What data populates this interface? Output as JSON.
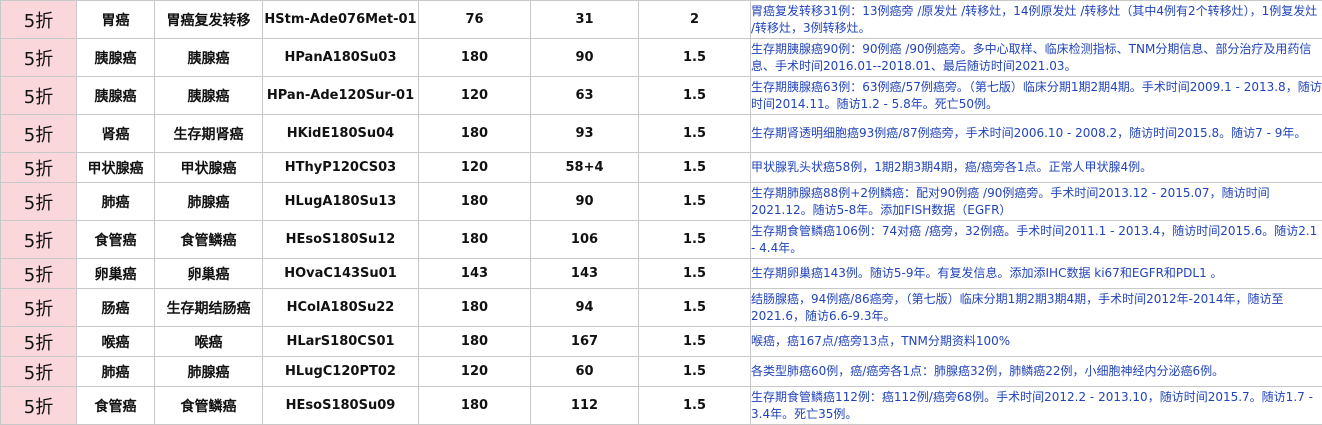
{
  "table": {
    "rows": [
      {
        "discount": "5折",
        "cancer": "胃癌",
        "subtype": "胃癌复发转移",
        "code": "HStm-Ade076Met-01",
        "cases": "76",
        "samples": "31",
        "size": "2",
        "desc": "胃癌复发转移31例：13例癌旁 /原发灶 /转移灶，14例原发灶 /转移灶（其中4例有2个转移灶），1例复发灶 /转移灶，3例转移灶。"
      },
      {
        "discount": "5折",
        "cancer": "胰腺癌",
        "subtype": "胰腺癌",
        "code": "HPanA180Su03",
        "cases": "180",
        "samples": "90",
        "size": "1.5",
        "desc": "生存期胰腺癌90例：90例癌 /90例癌旁。多中心取样、临床检测指标、TNM分期信息、部分治疗及用药信息、手术时间2016.01--2018.01、最后随访时间2021.03。"
      },
      {
        "discount": "5折",
        "cancer": "胰腺癌",
        "subtype": "胰腺癌",
        "code": "HPan-Ade120Sur-01",
        "cases": "120",
        "samples": "63",
        "size": "1.5",
        "desc": "生存期胰腺癌63例：63例癌/57例癌旁。（第七版）临床分期1期2期4期。手术时间2009.1 - 2013.8，随访时间2014.11。随访1.2 - 5.8年。死亡50例。"
      },
      {
        "discount": "5折",
        "cancer": "肾癌",
        "subtype": "生存期肾癌",
        "code": "HKidE180Su04",
        "cases": "180",
        "samples": "93",
        "size": "1.5",
        "desc": "生存期肾透明细胞癌93例癌/87例癌旁，手术时间2006.10 - 2008.2，随访时间2015.8。随访7 - 9年。"
      },
      {
        "discount": "5折",
        "cancer": "甲状腺癌",
        "subtype": "甲状腺癌",
        "code": "HThyP120CS03",
        "cases": "120",
        "samples": "58+4",
        "size": "1.5",
        "desc": "甲状腺乳头状癌58例，1期2期3期4期，癌/癌旁各1点。正常人甲状腺4例。"
      },
      {
        "discount": "5折",
        "cancer": "肺癌",
        "subtype": "肺腺癌",
        "code": "HLugA180Su13",
        "cases": "180",
        "samples": "90",
        "size": "1.5",
        "desc": "生存期肺腺癌88例+2例鳞癌：配对90例癌 /90例癌旁。手术时间2013.12 - 2015.07，随访时间2021.12。随访5-8年。添加FISH数据（EGFR）"
      },
      {
        "discount": "5折",
        "cancer": "食管癌",
        "subtype": "食管鳞癌",
        "code": "HEsoS180Su12",
        "cases": "180",
        "samples": "106",
        "size": "1.5",
        "desc": "生存期食管鳞癌106例：74对癌 /癌旁，32例癌。手术时间2011.1 - 2013.4，随访时间2015.6。随访2.1 - 4.4年。"
      },
      {
        "discount": "5折",
        "cancer": "卵巢癌",
        "subtype": "卵巢癌",
        "code": "HOvaC143Su01",
        "cases": "143",
        "samples": "143",
        "size": "1.5",
        "desc": "生存期卵巢癌143例。随访5-9年。有复发信息。添加添IHC数据 ki67和EGFR和PDL1 。"
      },
      {
        "discount": "5折",
        "cancer": "肠癌",
        "subtype": "生存期结肠癌",
        "code": "HColA180Su22",
        "cases": "180",
        "samples": "94",
        "size": "1.5",
        "desc": "结肠腺癌，94例癌/86癌旁，（第七版）临床分期1期2期3期4期，手术时间2012年-2014年，随访至2021.6，随访6.6-9.3年。"
      },
      {
        "discount": "5折",
        "cancer": "喉癌",
        "subtype": "喉癌",
        "code": "HLarS180CS01",
        "cases": "180",
        "samples": "167",
        "size": "1.5",
        "desc": "喉癌，癌167点/癌旁13点，TNM分期资料100%"
      },
      {
        "discount": "5折",
        "cancer": "肺癌",
        "subtype": "肺腺癌",
        "code": "HLugC120PT02",
        "cases": "120",
        "samples": "60",
        "size": "1.5",
        "desc": "各类型肺癌60例，癌/癌旁各1点：肺腺癌32例，肺鳞癌22例，小细胞神经内分泌癌6例。"
      },
      {
        "discount": "5折",
        "cancer": "食管癌",
        "subtype": "食管鳞癌",
        "code": "HEsoS180Su09",
        "cases": "180",
        "samples": "112",
        "size": "1.5",
        "desc": "生存期食管鳞癌112例：癌112例/癌旁68例。手术时间2012.2 - 2013.10，随访时间2015.7。随访1.7 - 3.4年。死亡35例。"
      }
    ]
  }
}
